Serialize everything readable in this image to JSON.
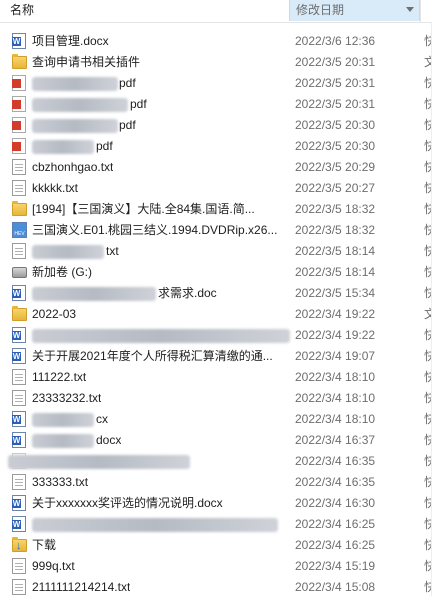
{
  "header": {
    "name_label": "名称",
    "date_label": "修改日期"
  },
  "rows": [
    {
      "name": "项目管理.docx",
      "date": "2022/3/6 12:36",
      "trail": "快",
      "icon": "word-doc-icon"
    },
    {
      "name": "查询申请书相关插件",
      "date": "2022/3/5 20:31",
      "trail": "文",
      "icon": "folder-icon"
    },
    {
      "name": "pdf",
      "date": "2022/3/5 20:31",
      "trail": "快",
      "icon": "pdf-icon"
    },
    {
      "name": "pdf",
      "date": "2022/3/5 20:31",
      "trail": "快",
      "icon": "pdf-icon"
    },
    {
      "name": "pdf",
      "date": "2022/3/5 20:30",
      "trail": "快",
      "icon": "pdf-icon"
    },
    {
      "name": "pdf",
      "date": "2022/3/5 20:30",
      "trail": "快",
      "icon": "pdf-icon"
    },
    {
      "name": "cbzhonhgao.txt",
      "date": "2022/3/5 20:29",
      "trail": "快",
      "icon": "text-file-icon"
    },
    {
      "name": "kkkkk.txt",
      "date": "2022/3/5 20:27",
      "trail": "快",
      "icon": "text-file-icon"
    },
    {
      "name": "[1994]【三国演义】大陆.全84集.国语.简...",
      "date": "2022/3/5 18:32",
      "trail": "快",
      "icon": "folder-icon"
    },
    {
      "name": "三国演义.E01.桃园三结义.1994.DVDRip.x26...",
      "date": "2022/3/5 18:32",
      "trail": "快",
      "icon": "video-file-icon"
    },
    {
      "name": "txt",
      "date": "2022/3/5 18:14",
      "trail": "快",
      "icon": "text-file-icon"
    },
    {
      "name": "新加卷 (G:)",
      "date": "2022/3/5 18:14",
      "trail": "快",
      "icon": "drive-icon"
    },
    {
      "name": "求需求.doc",
      "date": "2022/3/5 15:34",
      "trail": "快",
      "icon": "word-doc-icon"
    },
    {
      "name": "2022-03",
      "date": "2022/3/4 19:22",
      "trail": "文",
      "icon": "folder-icon"
    },
    {
      "name": "",
      "date": "2022/3/4 19:22",
      "trail": "快",
      "icon": "word-doc-icon"
    },
    {
      "name": "关于开展2021年度个人所得税汇算清缴的通...",
      "date": "2022/3/4 19:07",
      "trail": "快",
      "icon": "word-doc-icon"
    },
    {
      "name": "111222.txt",
      "date": "2022/3/4 18:10",
      "trail": "快",
      "icon": "text-file-icon"
    },
    {
      "name": "23333232.txt",
      "date": "2022/3/4 18:10",
      "trail": "快",
      "icon": "text-file-icon"
    },
    {
      "name": "cx",
      "date": "2022/3/4 18:10",
      "trail": "快",
      "icon": "word-doc-icon"
    },
    {
      "name": "docx",
      "date": "2022/3/4 16:37",
      "trail": "快",
      "icon": "word-doc-icon"
    },
    {
      "name": "",
      "date": "2022/3/4 16:35",
      "trail": "快",
      "icon": "generic-file-icon"
    },
    {
      "name": "333333.txt",
      "date": "2022/3/4 16:35",
      "trail": "快",
      "icon": "text-file-icon"
    },
    {
      "name": "关于xxxxxxx奖评选的情况说明.docx",
      "date": "2022/3/4 16:30",
      "trail": "快",
      "icon": "word-doc-icon"
    },
    {
      "name": "",
      "date": "2022/3/4 16:25",
      "trail": "快",
      "icon": "word-doc-icon"
    },
    {
      "name": "下载",
      "date": "2022/3/4 16:25",
      "trail": "快",
      "icon": "download-folder-icon"
    },
    {
      "name": "999q.txt",
      "date": "2022/3/4 15:19",
      "trail": "快",
      "icon": "text-file-icon"
    },
    {
      "name": "2111111214214.txt",
      "date": "2022/3/4 15:08",
      "trail": "快",
      "icon": "text-file-icon"
    }
  ]
}
